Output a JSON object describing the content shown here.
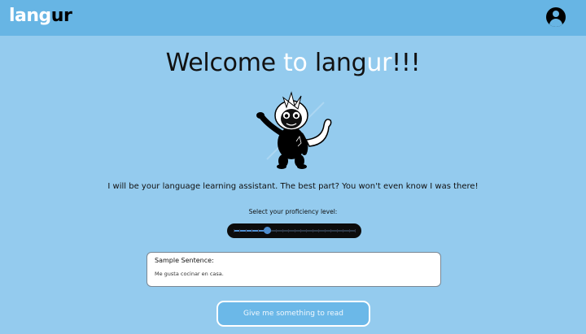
{
  "header": {
    "logo_part1": "lang",
    "logo_part2": "ur",
    "account_icon": "user-circle-icon"
  },
  "welcome": {
    "part1": "Welcome ",
    "part2": "to",
    "part3": " lang",
    "part4": "ur",
    "part5": "!!!"
  },
  "tagline": "I will be your language learning assistant. The best part? You won't even know I was there!",
  "proficiency": {
    "label": "Select your proficiency level:",
    "value_fraction": 0.28,
    "tick_count": 20
  },
  "sample": {
    "title": "Sample Sentence:",
    "text": "Me gusta cocinar en casa."
  },
  "read_button": "Give me something to read",
  "colors": {
    "header_bg": "#67b5e4",
    "page_bg": "#94cbee",
    "accent_white": "#ffffff",
    "slider_bg": "#0c0c0c",
    "slider_accent": "#4f8fd0"
  }
}
